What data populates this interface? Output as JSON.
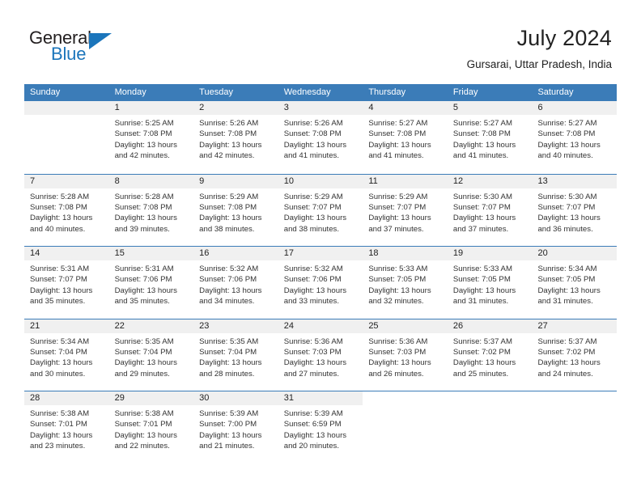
{
  "brand": {
    "name_part1": "General",
    "name_part2": "Blue",
    "logo_icon": "triangle-flag-icon"
  },
  "header": {
    "title": "July 2024",
    "subtitle": "Gursarai, Uttar Pradesh, India"
  },
  "theme": {
    "header_blue": "#3b7cb8",
    "brand_blue": "#1b75bb",
    "daynum_band": "#f0f0f0",
    "text": "#222222"
  },
  "weekdays": [
    "Sunday",
    "Monday",
    "Tuesday",
    "Wednesday",
    "Thursday",
    "Friday",
    "Saturday"
  ],
  "weeks": [
    [
      {
        "day": "",
        "sunrise": "",
        "sunset": "",
        "daylight_line1": "",
        "daylight_line2": ""
      },
      {
        "day": "1",
        "sunrise": "Sunrise: 5:25 AM",
        "sunset": "Sunset: 7:08 PM",
        "daylight_line1": "Daylight: 13 hours",
        "daylight_line2": "and 42 minutes."
      },
      {
        "day": "2",
        "sunrise": "Sunrise: 5:26 AM",
        "sunset": "Sunset: 7:08 PM",
        "daylight_line1": "Daylight: 13 hours",
        "daylight_line2": "and 42 minutes."
      },
      {
        "day": "3",
        "sunrise": "Sunrise: 5:26 AM",
        "sunset": "Sunset: 7:08 PM",
        "daylight_line1": "Daylight: 13 hours",
        "daylight_line2": "and 41 minutes."
      },
      {
        "day": "4",
        "sunrise": "Sunrise: 5:27 AM",
        "sunset": "Sunset: 7:08 PM",
        "daylight_line1": "Daylight: 13 hours",
        "daylight_line2": "and 41 minutes."
      },
      {
        "day": "5",
        "sunrise": "Sunrise: 5:27 AM",
        "sunset": "Sunset: 7:08 PM",
        "daylight_line1": "Daylight: 13 hours",
        "daylight_line2": "and 41 minutes."
      },
      {
        "day": "6",
        "sunrise": "Sunrise: 5:27 AM",
        "sunset": "Sunset: 7:08 PM",
        "daylight_line1": "Daylight: 13 hours",
        "daylight_line2": "and 40 minutes."
      }
    ],
    [
      {
        "day": "7",
        "sunrise": "Sunrise: 5:28 AM",
        "sunset": "Sunset: 7:08 PM",
        "daylight_line1": "Daylight: 13 hours",
        "daylight_line2": "and 40 minutes."
      },
      {
        "day": "8",
        "sunrise": "Sunrise: 5:28 AM",
        "sunset": "Sunset: 7:08 PM",
        "daylight_line1": "Daylight: 13 hours",
        "daylight_line2": "and 39 minutes."
      },
      {
        "day": "9",
        "sunrise": "Sunrise: 5:29 AM",
        "sunset": "Sunset: 7:08 PM",
        "daylight_line1": "Daylight: 13 hours",
        "daylight_line2": "and 38 minutes."
      },
      {
        "day": "10",
        "sunrise": "Sunrise: 5:29 AM",
        "sunset": "Sunset: 7:07 PM",
        "daylight_line1": "Daylight: 13 hours",
        "daylight_line2": "and 38 minutes."
      },
      {
        "day": "11",
        "sunrise": "Sunrise: 5:29 AM",
        "sunset": "Sunset: 7:07 PM",
        "daylight_line1": "Daylight: 13 hours",
        "daylight_line2": "and 37 minutes."
      },
      {
        "day": "12",
        "sunrise": "Sunrise: 5:30 AM",
        "sunset": "Sunset: 7:07 PM",
        "daylight_line1": "Daylight: 13 hours",
        "daylight_line2": "and 37 minutes."
      },
      {
        "day": "13",
        "sunrise": "Sunrise: 5:30 AM",
        "sunset": "Sunset: 7:07 PM",
        "daylight_line1": "Daylight: 13 hours",
        "daylight_line2": "and 36 minutes."
      }
    ],
    [
      {
        "day": "14",
        "sunrise": "Sunrise: 5:31 AM",
        "sunset": "Sunset: 7:07 PM",
        "daylight_line1": "Daylight: 13 hours",
        "daylight_line2": "and 35 minutes."
      },
      {
        "day": "15",
        "sunrise": "Sunrise: 5:31 AM",
        "sunset": "Sunset: 7:06 PM",
        "daylight_line1": "Daylight: 13 hours",
        "daylight_line2": "and 35 minutes."
      },
      {
        "day": "16",
        "sunrise": "Sunrise: 5:32 AM",
        "sunset": "Sunset: 7:06 PM",
        "daylight_line1": "Daylight: 13 hours",
        "daylight_line2": "and 34 minutes."
      },
      {
        "day": "17",
        "sunrise": "Sunrise: 5:32 AM",
        "sunset": "Sunset: 7:06 PM",
        "daylight_line1": "Daylight: 13 hours",
        "daylight_line2": "and 33 minutes."
      },
      {
        "day": "18",
        "sunrise": "Sunrise: 5:33 AM",
        "sunset": "Sunset: 7:05 PM",
        "daylight_line1": "Daylight: 13 hours",
        "daylight_line2": "and 32 minutes."
      },
      {
        "day": "19",
        "sunrise": "Sunrise: 5:33 AM",
        "sunset": "Sunset: 7:05 PM",
        "daylight_line1": "Daylight: 13 hours",
        "daylight_line2": "and 31 minutes."
      },
      {
        "day": "20",
        "sunrise": "Sunrise: 5:34 AM",
        "sunset": "Sunset: 7:05 PM",
        "daylight_line1": "Daylight: 13 hours",
        "daylight_line2": "and 31 minutes."
      }
    ],
    [
      {
        "day": "21",
        "sunrise": "Sunrise: 5:34 AM",
        "sunset": "Sunset: 7:04 PM",
        "daylight_line1": "Daylight: 13 hours",
        "daylight_line2": "and 30 minutes."
      },
      {
        "day": "22",
        "sunrise": "Sunrise: 5:35 AM",
        "sunset": "Sunset: 7:04 PM",
        "daylight_line1": "Daylight: 13 hours",
        "daylight_line2": "and 29 minutes."
      },
      {
        "day": "23",
        "sunrise": "Sunrise: 5:35 AM",
        "sunset": "Sunset: 7:04 PM",
        "daylight_line1": "Daylight: 13 hours",
        "daylight_line2": "and 28 minutes."
      },
      {
        "day": "24",
        "sunrise": "Sunrise: 5:36 AM",
        "sunset": "Sunset: 7:03 PM",
        "daylight_line1": "Daylight: 13 hours",
        "daylight_line2": "and 27 minutes."
      },
      {
        "day": "25",
        "sunrise": "Sunrise: 5:36 AM",
        "sunset": "Sunset: 7:03 PM",
        "daylight_line1": "Daylight: 13 hours",
        "daylight_line2": "and 26 minutes."
      },
      {
        "day": "26",
        "sunrise": "Sunrise: 5:37 AM",
        "sunset": "Sunset: 7:02 PM",
        "daylight_line1": "Daylight: 13 hours",
        "daylight_line2": "and 25 minutes."
      },
      {
        "day": "27",
        "sunrise": "Sunrise: 5:37 AM",
        "sunset": "Sunset: 7:02 PM",
        "daylight_line1": "Daylight: 13 hours",
        "daylight_line2": "and 24 minutes."
      }
    ],
    [
      {
        "day": "28",
        "sunrise": "Sunrise: 5:38 AM",
        "sunset": "Sunset: 7:01 PM",
        "daylight_line1": "Daylight: 13 hours",
        "daylight_line2": "and 23 minutes."
      },
      {
        "day": "29",
        "sunrise": "Sunrise: 5:38 AM",
        "sunset": "Sunset: 7:01 PM",
        "daylight_line1": "Daylight: 13 hours",
        "daylight_line2": "and 22 minutes."
      },
      {
        "day": "30",
        "sunrise": "Sunrise: 5:39 AM",
        "sunset": "Sunset: 7:00 PM",
        "daylight_line1": "Daylight: 13 hours",
        "daylight_line2": "and 21 minutes."
      },
      {
        "day": "31",
        "sunrise": "Sunrise: 5:39 AM",
        "sunset": "Sunset: 6:59 PM",
        "daylight_line1": "Daylight: 13 hours",
        "daylight_line2": "and 20 minutes."
      },
      {
        "day": "",
        "sunrise": "",
        "sunset": "",
        "daylight_line1": "",
        "daylight_line2": ""
      },
      {
        "day": "",
        "sunrise": "",
        "sunset": "",
        "daylight_line1": "",
        "daylight_line2": ""
      },
      {
        "day": "",
        "sunrise": "",
        "sunset": "",
        "daylight_line1": "",
        "daylight_line2": ""
      }
    ]
  ]
}
